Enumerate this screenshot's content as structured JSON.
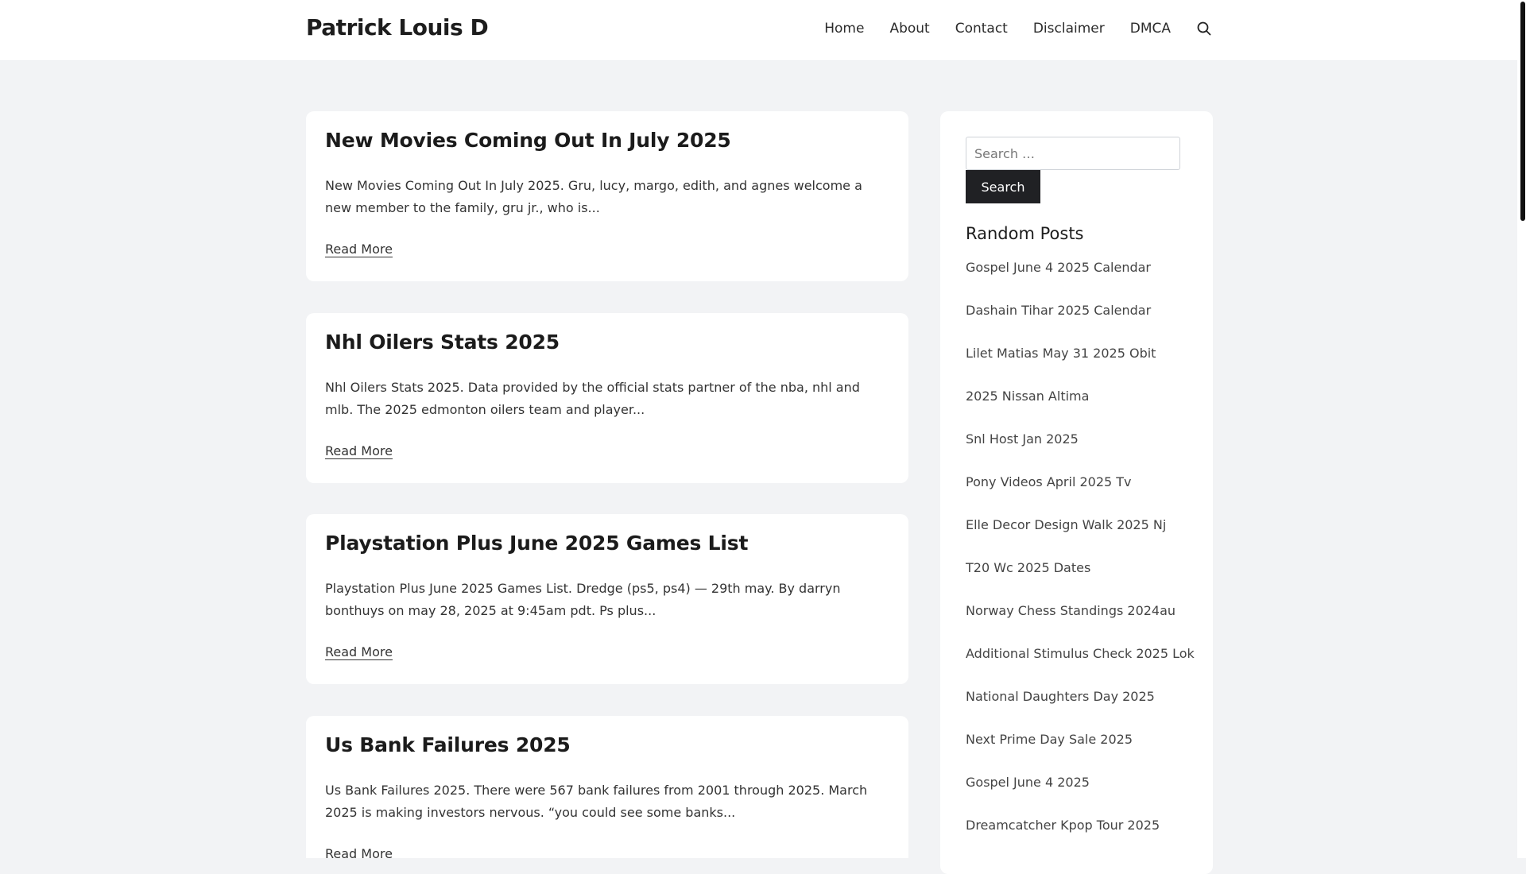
{
  "site": {
    "title": "Patrick Louis D"
  },
  "nav": {
    "items": [
      "Home",
      "About",
      "Contact",
      "Disclaimer",
      "DMCA"
    ],
    "search_icon": "search-icon"
  },
  "posts": [
    {
      "title": "New Movies Coming Out In July 2025",
      "excerpt": "New Movies Coming Out In July 2025. Gru, lucy, margo, edith, and agnes welcome a new member to the family, gru jr., who is...",
      "read_more": "Read More"
    },
    {
      "title": "Nhl Oilers Stats 2025",
      "excerpt": "Nhl Oilers Stats 2025. Data provided by the official stats partner of the nba, nhl and mlb. The 2025 edmonton oilers team and player...",
      "read_more": "Read More"
    },
    {
      "title": "Playstation Plus June 2025 Games List",
      "excerpt": "Playstation Plus June 2025 Games List. Dredge (ps5, ps4) — 29th may. By darryn bonthuys on may 28, 2025 at 9:45am pdt. Ps plus...",
      "read_more": "Read More"
    },
    {
      "title": "Us Bank Failures 2025",
      "excerpt": "Us Bank Failures 2025. There were 567 bank failures from 2001 through 2025. March 2025 is making investors nervous. “you could see some banks...",
      "read_more": "Read More"
    }
  ],
  "sidebar": {
    "search_placeholder": "Search …",
    "search_button": "Search",
    "random_posts_title": "Random Posts",
    "random_posts": [
      "Gospel June 4 2025 Calendar",
      "Dashain Tihar 2025 Calendar",
      "Lilet Matias May 31 2025 Obit",
      "2025 Nissan Altima",
      "Snl Host Jan 2025",
      "Pony Videos April 2025 Tv",
      "Elle Decor Design Walk 2025 Nj",
      "T20 Wc 2025 Dates",
      "Norway Chess Standings 2024au",
      "Additional Stimulus Check 2025 Lok",
      "National Daughters Day 2025",
      "Next Prime Day Sale 2025",
      "Gospel June 4 2025",
      "Dreamcatcher Kpop Tour 2025"
    ]
  }
}
